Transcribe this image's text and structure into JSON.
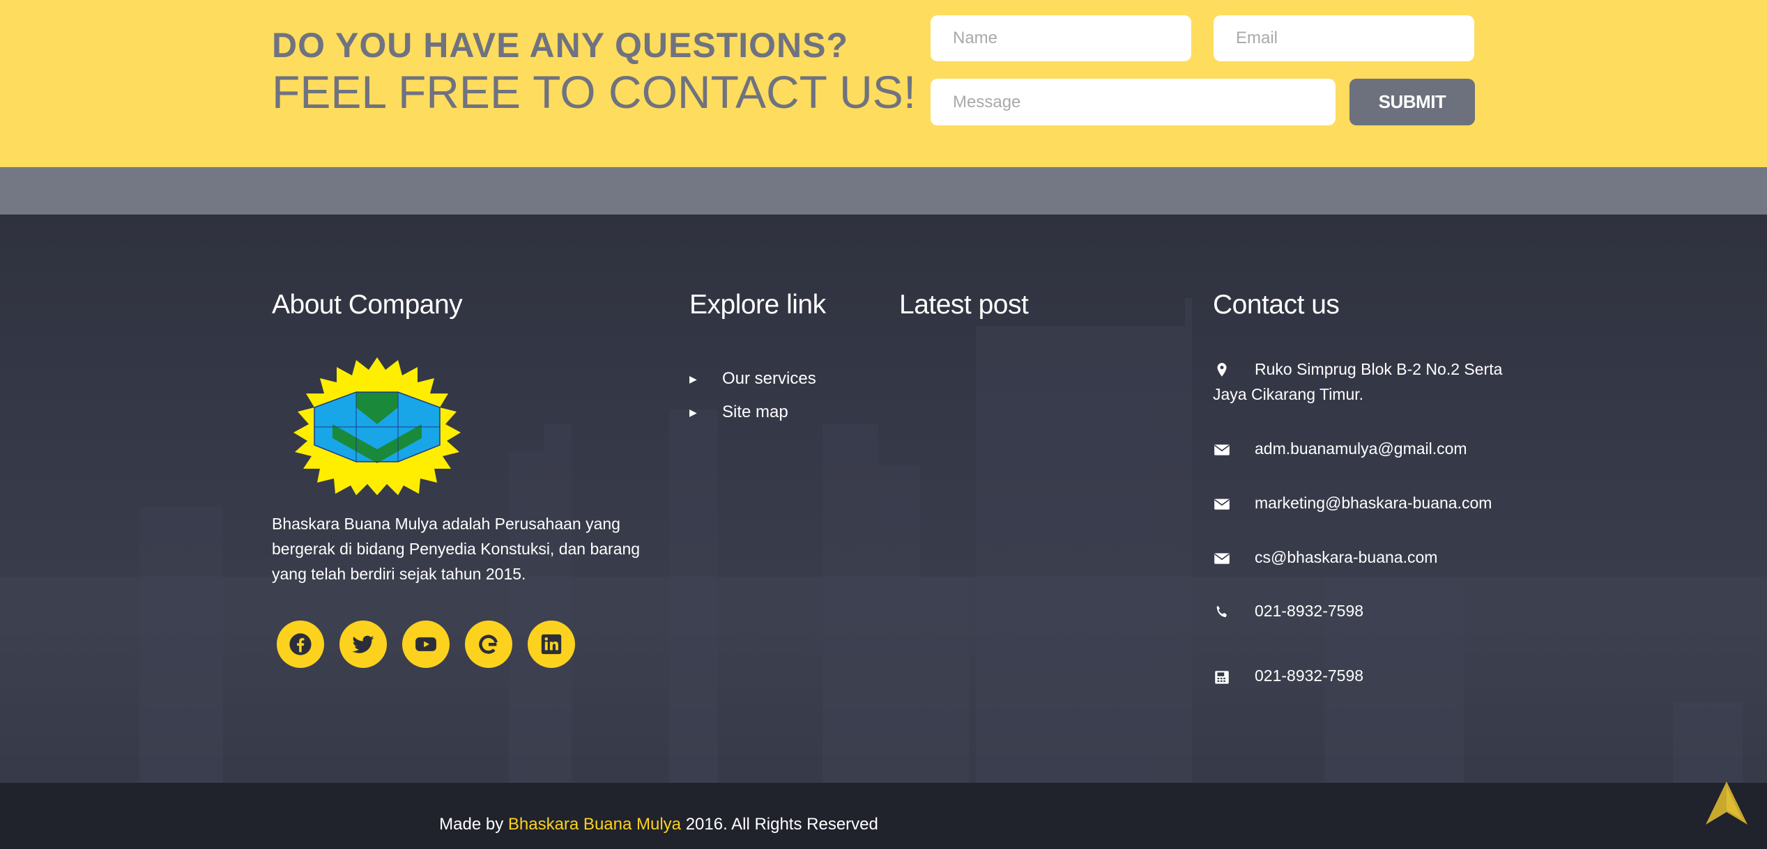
{
  "cta": {
    "question": "DO YOU HAVE ANY QUESTIONS?",
    "contact_line": "FEEL FREE TO CONTACT US!",
    "name_placeholder": "Name",
    "email_placeholder": "Email",
    "message_placeholder": "Message",
    "submit_label": "SUBMIT"
  },
  "footer": {
    "about": {
      "title": "About Company",
      "logo_icon": "company-logo-sunburst",
      "description": "Bhaskara Buana Mulya adalah Perusahaan yang bergerak di bidang Penyedia Konstuksi, dan barang yang telah berdiri sejak tahun 2015.",
      "socials": [
        {
          "name": "facebook-icon"
        },
        {
          "name": "twitter-icon"
        },
        {
          "name": "youtube-icon"
        },
        {
          "name": "google-icon"
        },
        {
          "name": "linkedin-icon"
        }
      ]
    },
    "explore": {
      "title": "Explore link",
      "links": [
        "Our services",
        "Site map"
      ]
    },
    "latest": {
      "title": "Latest post"
    },
    "contact": {
      "title": "Contact us",
      "address": "Ruko Simprug Blok B-2 No.2 Serta Jaya Cikarang Timur.",
      "email_1": "adm.buanamulya@gmail.com",
      "email_2": "marketing@bhaskara-buana.com",
      "email_3": "cs@bhaskara-buana.com",
      "phone": "021-8932-7598",
      "fax": "021-8932-7598"
    }
  },
  "bottom": {
    "made_by": "Made by",
    "brand": "Bhaskara Buana Mulya",
    "rights": "2016. All Rights Reserved"
  },
  "colors": {
    "banner_yellow": "#fedc5d",
    "accent_yellow": "#fcd21e",
    "submit_gray": "#6d717e",
    "footer_dark": "#2b2e3a",
    "bottom_dark": "#20222c"
  }
}
